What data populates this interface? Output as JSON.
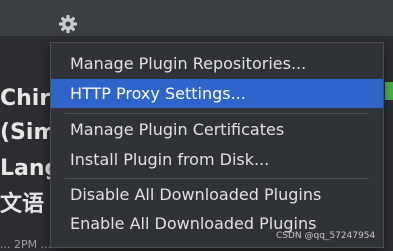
{
  "toolbar": {
    "settings_icon": "gear-icon"
  },
  "background": {
    "lines": [
      "Chir",
      "(Sim",
      "Lang",
      "文语"
    ],
    "bottom_text": "... 2PM ... LL ... NM ..."
  },
  "menu": {
    "items": [
      "Manage Plugin Repositories...",
      "HTTP Proxy Settings...",
      "Manage Plugin Certificates",
      "Install Plugin from Disk...",
      "Disable All Downloaded Plugins",
      "Enable All Downloaded Plugins"
    ],
    "selected_index": 1
  },
  "watermark": "CSDN @qq_57247954",
  "colors": {
    "menu_bg": "#2f3237",
    "selection": "#2f65ca",
    "text": "#dfe1e5",
    "accent_green": "#4caf50"
  }
}
